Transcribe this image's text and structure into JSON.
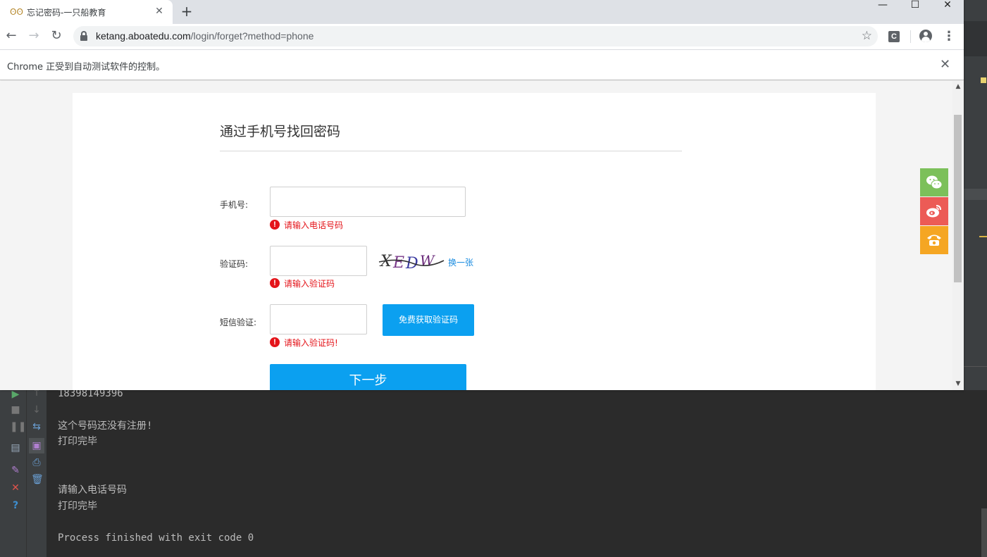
{
  "browser": {
    "tab": {
      "title": "忘记密码-一只船教育",
      "close_glyph": "✕"
    },
    "new_tab_glyph": "+",
    "window_controls": {
      "minimize": "—",
      "maximize": "☐",
      "close": "✕"
    },
    "nav": {
      "back": "←",
      "forward": "→",
      "reload": "↻"
    },
    "address": {
      "host": "ketang.aboatedu.com",
      "path": "/login/forget?method=phone"
    },
    "bookmark_glyph": "☆",
    "extension_label": "C",
    "menu_glyph": "⋮",
    "infobar": {
      "message": "Chrome 正受到自动测试软件的控制。",
      "close_glyph": "✕"
    }
  },
  "page": {
    "heading": "通过手机号找回密码",
    "form": {
      "phone": {
        "label": "手机号:",
        "value": "",
        "error": "请输入电话号码"
      },
      "captcha": {
        "label": "验证码:",
        "value": "",
        "error": "请输入验证码",
        "image_text": "XEDW",
        "refresh_link": "换一张"
      },
      "sms": {
        "label": "短信验证:",
        "value": "",
        "error": "请输入验证码!",
        "send_button": "免费获取验证码"
      },
      "error_glyph": "!",
      "next_button": "下一步"
    },
    "side_social": [
      {
        "name": "wechat",
        "color": "#7cc05a"
      },
      {
        "name": "weibo",
        "color": "#ec5b56"
      },
      {
        "name": "phone",
        "color": "#f5a623"
      }
    ]
  },
  "console": {
    "lines": [
      "18398149396",
      "",
      "这个号码还没有注册!",
      "打印完毕",
      "",
      "",
      "请输入电话号码",
      "打印完毕",
      "",
      "Process finished with exit code 0"
    ]
  }
}
